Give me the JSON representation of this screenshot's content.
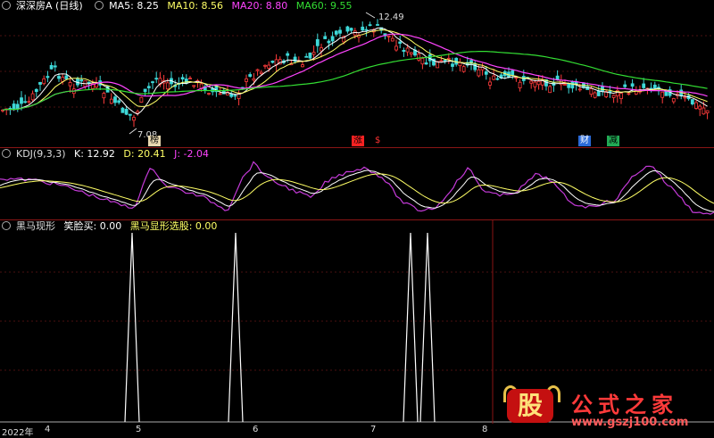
{
  "main_header": {
    "title": "深深房A (日线)",
    "ma5": "MA5: 8.25",
    "ma10": "MA10: 8.56",
    "ma20": "MA20: 8.80",
    "ma60": "MA60: 9.55",
    "colors": {
      "ma5": "#ffffff",
      "ma10": "#ffff66",
      "ma20": "#ff44ff",
      "ma60": "#33dd33"
    }
  },
  "annotations": {
    "high": "12.49",
    "low": "7.08"
  },
  "markers": [
    {
      "text": "榜",
      "bg": "#e8d8b0",
      "color": "#000"
    },
    {
      "text": "涨",
      "bg": "#ff2222",
      "color": "#000"
    },
    {
      "text": "$",
      "bg": "",
      "color": "#ff3333"
    },
    {
      "text": "财",
      "bg": "#2a6ad8",
      "color": "#fff"
    },
    {
      "text": "减",
      "bg": "#22aa55",
      "color": "#000"
    }
  ],
  "kdj_header": {
    "name": "KDJ(9,3,3)",
    "k": "K: 12.92",
    "d": "D: 20.41",
    "j": "J: -2.04",
    "colors": {
      "k": "#ffffff",
      "d": "#ffff66",
      "j": "#ff44ff"
    }
  },
  "ind_header": {
    "name": "黑马现形",
    "xiaolian": "笑脸买: 0.00",
    "heima": "黑马显形选股: 0.00",
    "colors": {
      "xiaolian": "#ffffff",
      "heima": "#ffff66"
    }
  },
  "x_axis": {
    "labels": [
      "2022年",
      "4",
      "5",
      "6",
      "7",
      "8"
    ]
  },
  "logo": {
    "badge": "股",
    "title": "公式之家",
    "url": "www.gszj100.com"
  },
  "colors": {
    "up": "#ff3b3b",
    "down": "#3ed8d8",
    "separator": "#8a1515",
    "signal": "#ffffff"
  }
}
